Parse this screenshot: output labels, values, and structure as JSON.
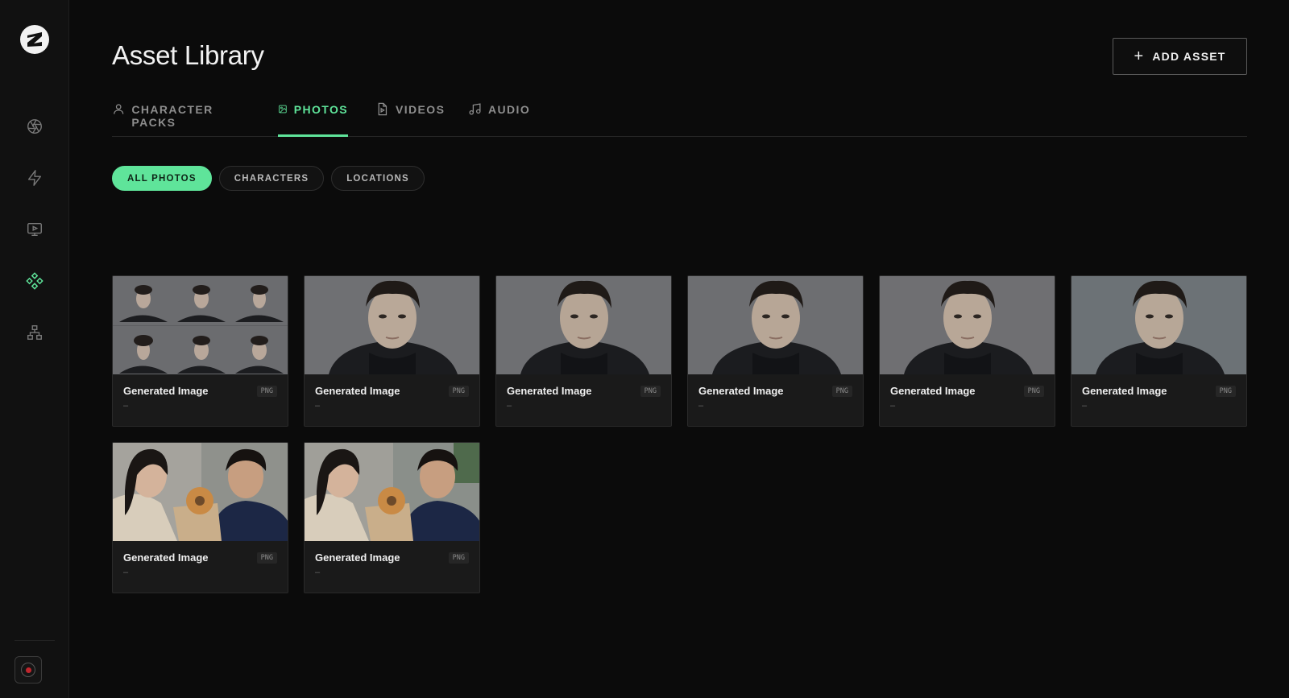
{
  "sidebar": {
    "items": [
      {
        "name": "camera-aperture-icon"
      },
      {
        "name": "lightning-icon"
      },
      {
        "name": "video-screen-icon"
      },
      {
        "name": "asset-library-icon"
      },
      {
        "name": "hierarchy-icon"
      }
    ],
    "accent": "#5fe49a"
  },
  "header": {
    "title": "Asset Library",
    "add_button_label": "ADD ASSET"
  },
  "tabs": [
    {
      "label": "CHARACTER PACKS",
      "icon": "user-icon",
      "active": false
    },
    {
      "label": "PHOTOS",
      "icon": "image-icon",
      "active": true
    },
    {
      "label": "VIDEOS",
      "icon": "video-file-icon",
      "active": false
    },
    {
      "label": "AUDIO",
      "icon": "music-note-icon",
      "active": false
    }
  ],
  "filters": [
    {
      "label": "ALL PHOTOS",
      "active": true
    },
    {
      "label": "CHARACTERS",
      "active": false
    },
    {
      "label": "LOCATIONS",
      "active": false
    }
  ],
  "assets": [
    {
      "title": "Generated Image",
      "format": "PNG",
      "subtitle": "–"
    },
    {
      "title": "Generated Image",
      "format": "PNG",
      "subtitle": "–"
    },
    {
      "title": "Generated Image",
      "format": "PNG",
      "subtitle": "–"
    },
    {
      "title": "Generated Image",
      "format": "PNG",
      "subtitle": "–"
    },
    {
      "title": "Generated Image",
      "format": "PNG",
      "subtitle": "–"
    },
    {
      "title": "Generated Image",
      "format": "PNG",
      "subtitle": "–"
    },
    {
      "title": "Generated Image",
      "format": "PNG",
      "subtitle": "–"
    },
    {
      "title": "Generated Image",
      "format": "PNG",
      "subtitle": "–"
    }
  ]
}
